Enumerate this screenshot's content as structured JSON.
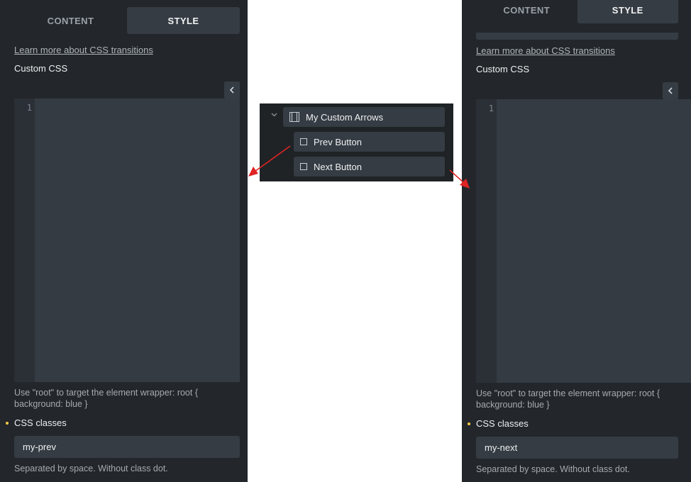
{
  "left_panel": {
    "tabs": [
      {
        "label": "CONTENT",
        "active": false
      },
      {
        "label": "STYLE",
        "active": true
      }
    ],
    "learn_more_link": "Learn more about CSS transitions",
    "custom_css_label": "Custom CSS",
    "collapse_icon": "chevron-left-icon",
    "editor": {
      "line_numbers": [
        "1"
      ],
      "code": ""
    },
    "root_help": "Use \"root\" to target the element wrapper: root { background: blue }",
    "css_classes_label": "CSS classes",
    "css_classes_value": "my-prev",
    "separator_help": "Separated by space. Without class dot."
  },
  "structure_panel": {
    "parent": {
      "label": "My Custom Arrows",
      "icon": "slider-frame-icon",
      "expanded": true
    },
    "children": [
      {
        "label": "Prev Button",
        "icon": "square-icon"
      },
      {
        "label": "Next Button",
        "icon": "square-icon"
      }
    ]
  },
  "right_panel": {
    "tabs": [
      {
        "label": "CONTENT",
        "active": false
      },
      {
        "label": "STYLE",
        "active": true
      }
    ],
    "learn_more_link": "Learn more about CSS transitions",
    "custom_css_label": "Custom CSS",
    "collapse_icon": "chevron-left-icon",
    "editor": {
      "line_numbers": [
        "1"
      ],
      "code": ""
    },
    "root_help": "Use \"root\" to target the element wrapper: root { background: blue }",
    "css_classes_label": "CSS classes",
    "css_classes_value": "my-next",
    "separator_help": "Separated by space. Without class dot."
  },
  "colors": {
    "panel_bg": "#23272b",
    "field_bg": "#353c43",
    "accent_dot": "#f7c948",
    "annotation_arrow": "#e02424"
  }
}
